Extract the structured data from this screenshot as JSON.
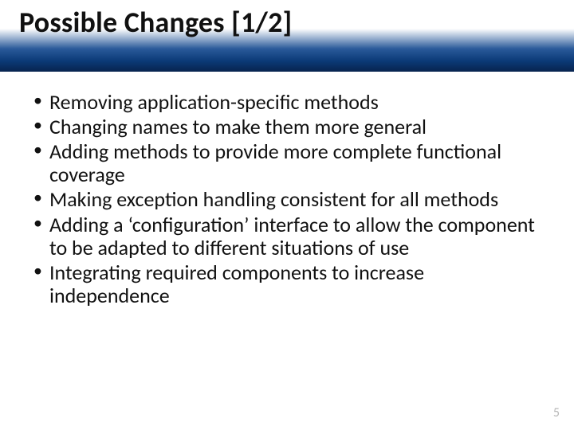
{
  "title": "Possible Changes [1/2]",
  "bullets": [
    "Removing application-specific methods",
    "Changing names to make them more general",
    "Adding methods to provide more complete functional coverage",
    "Making exception handling consistent for all methods",
    "Adding a ‘configuration’ interface to allow the component to be adapted to different situations of use",
    "Integrating required components to increase independence"
  ],
  "page_number": "5"
}
